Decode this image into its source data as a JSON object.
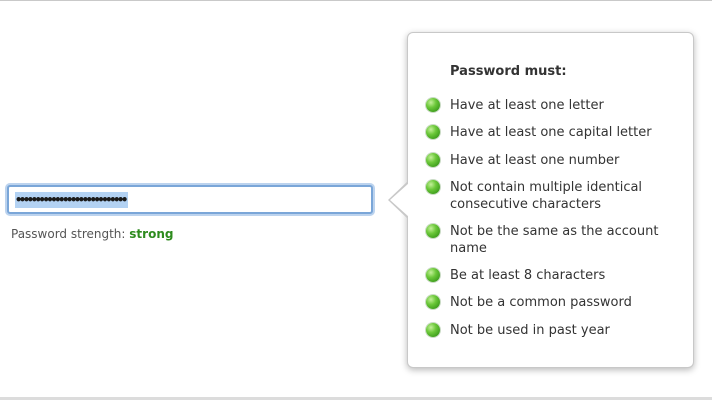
{
  "password_field": {
    "value": "••••••••••••••••••••••••••••"
  },
  "strength": {
    "label": "Password strength:",
    "value": "strong",
    "value_color": "#2e8b1e"
  },
  "popover": {
    "title": "Password must:",
    "rules": [
      {
        "text": "Have at least one letter",
        "status": "met",
        "icon": "green-check-dot-icon"
      },
      {
        "text": "Have at least one capital letter",
        "status": "met",
        "icon": "green-check-dot-icon"
      },
      {
        "text": "Have at least one number",
        "status": "met",
        "icon": "green-check-dot-icon"
      },
      {
        "text": "Not contain multiple identical consecutive characters",
        "status": "met",
        "icon": "green-check-dot-icon"
      },
      {
        "text": "Not be the same as the account name",
        "status": "met",
        "icon": "green-check-dot-icon"
      },
      {
        "text": "Be at least 8 characters",
        "status": "met",
        "icon": "green-check-dot-icon"
      },
      {
        "text": "Not be a common password",
        "status": "met",
        "icon": "green-check-dot-icon"
      },
      {
        "text": "Not be used in past year",
        "status": "met",
        "icon": "green-check-dot-icon"
      }
    ]
  },
  "colors": {
    "met_indicator": "#4caf2a",
    "focus_ring": "#7aa6d8",
    "selection": "#b3d2f3"
  }
}
